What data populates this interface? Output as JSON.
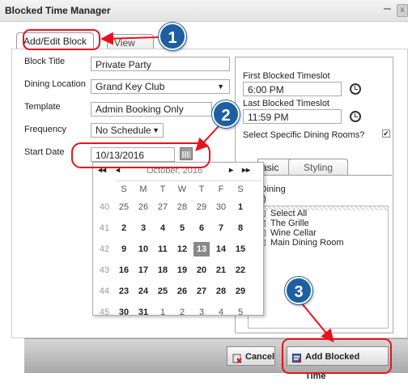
{
  "window": {
    "title": "Blocked Time Manager",
    "minimize_glyph": "–",
    "close_glyph": "x"
  },
  "tabs": {
    "add_edit": "Add/Edit Block",
    "view": "View Blo"
  },
  "form": {
    "block_title_label": "Block Title",
    "block_title_value": "Private Party",
    "dining_location_label": "Dining Location",
    "dining_location_value": "Grand Key Club",
    "template_label": "Template",
    "template_value": "Admin Booking Only",
    "frequency_label": "Frequency",
    "frequency_value": "No Schedule",
    "start_date_label": "Start Date",
    "start_date_value": "10/13/2016"
  },
  "right_panel": {
    "first_label": "First Blocked Timeslot",
    "first_value": "6:00 PM",
    "last_label": "Last Blocked Timeslot",
    "last_value": "11:59 PM",
    "specific_rooms_label": "Select Specific Dining Rooms?",
    "specific_rooms_checked": true,
    "subtabs": [
      "asic",
      "Styling"
    ],
    "dining_heading_line1": "l Dining",
    "dining_heading_line2": "(s)",
    "rooms": [
      {
        "label": "Select All",
        "checked": false
      },
      {
        "label": "The Grille",
        "checked": true
      },
      {
        "label": "Wine Cellar",
        "checked": false
      },
      {
        "label": "Main Dining Room",
        "checked": false
      }
    ]
  },
  "calendar": {
    "month_label": "October, 2016",
    "nav_prev_year": "◂◂",
    "nav_prev": "◂",
    "nav_next": "▸",
    "nav_next_year": "▸▸",
    "dow": [
      "S",
      "M",
      "T",
      "W",
      "T",
      "F",
      "S"
    ],
    "weeks": [
      {
        "wk": "40",
        "days": [
          "25",
          "26",
          "27",
          "28",
          "29",
          "30",
          "1"
        ]
      },
      {
        "wk": "41",
        "days": [
          "2",
          "3",
          "4",
          "5",
          "6",
          "7",
          "8"
        ]
      },
      {
        "wk": "42",
        "days": [
          "9",
          "10",
          "11",
          "12",
          "13",
          "14",
          "15"
        ]
      },
      {
        "wk": "43",
        "days": [
          "16",
          "17",
          "18",
          "19",
          "20",
          "21",
          "22"
        ]
      },
      {
        "wk": "44",
        "days": [
          "23",
          "24",
          "25",
          "26",
          "27",
          "28",
          "29"
        ]
      },
      {
        "wk": "45",
        "days": [
          "30",
          "31",
          "1",
          "2",
          "3",
          "4",
          "5"
        ]
      }
    ],
    "selected_day": "13"
  },
  "footer": {
    "cancel_label": "Cancel",
    "add_label": "Add Blocked Time"
  },
  "callouts": [
    "1",
    "2",
    "3"
  ],
  "colors": {
    "callout_red": "#e8121e",
    "badge_blue": "#1d5fa0"
  }
}
